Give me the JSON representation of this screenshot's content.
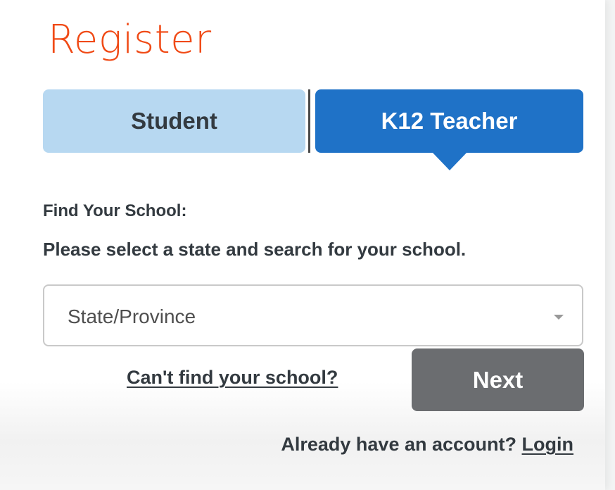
{
  "page": {
    "title": "Register"
  },
  "tabs": {
    "student": "Student",
    "teacher": "K12 Teacher",
    "active": "teacher"
  },
  "form": {
    "find_school_label": "Find Your School:",
    "instructions": "Please select a state and search for your school.",
    "state_select": {
      "value": "State/Province",
      "options": [
        "State/Province"
      ]
    },
    "cant_find_link": "Can't find your school?",
    "next_button": "Next"
  },
  "footer": {
    "account_prompt": "Already have an account?",
    "login_link": "Login"
  },
  "colors": {
    "title": "#f04a16",
    "tab_active": "#1f72c7",
    "tab_inactive": "#b7d8f1",
    "next_button": "#6b6d70",
    "text": "#333a40"
  },
  "icons": {
    "select_caret": "caret-down-icon",
    "tab_pointer": "pointer-arrow-icon"
  }
}
